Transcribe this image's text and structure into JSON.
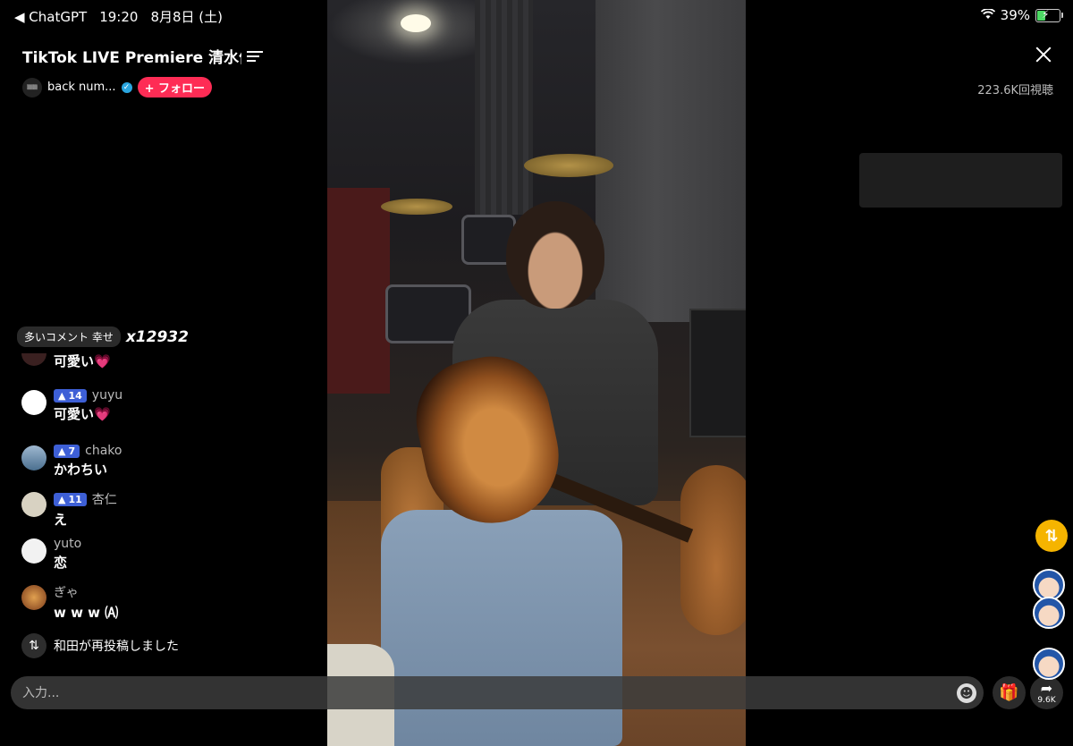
{
  "status_bar": {
    "back_app": "◀ ChatGPT",
    "time": "19:20",
    "date": "8月8日 (土)",
    "battery_pct": "39%",
    "battery_level": 0.39
  },
  "header": {
    "title": "TikTok LIVE Premiere 清水依与",
    "host_name": "back num...",
    "follow_label": "+ フォロー",
    "viewers": "223.6K回視聴"
  },
  "hot_comment": {
    "label": "多いコメント 幸せ",
    "count": "x12932"
  },
  "comments": [
    {
      "user": "",
      "level": "",
      "text": "可愛い💗",
      "avatar_color": "#3a2020"
    },
    {
      "user": "yuyu",
      "level": "14",
      "text": "可愛い💗",
      "avatar_color": "#ffffff"
    },
    {
      "user": "chako",
      "level": "7",
      "text": "かわちい",
      "avatar_color": "#6a8fb0"
    },
    {
      "user": "杏仁",
      "level": "11",
      "text": "え",
      "avatar_color": "#d8d2c2"
    },
    {
      "user": "yuto",
      "level": "",
      "text": "恋",
      "avatar_color": "#f2f2f2"
    },
    {
      "user": "ぎゃ",
      "level": "",
      "text": "w w w 🄐",
      "avatar_color": "#c9823a"
    }
  ],
  "repost_notice": "和田が再投稿しました",
  "input": {
    "placeholder": "入力..."
  },
  "actions": {
    "share_count": "9.6K"
  },
  "icons": {
    "back": "back-chevron-icon",
    "wifi": "wifi-icon",
    "battery": "battery-icon",
    "list": "list-icon",
    "close": "close-icon",
    "emoji": "emoji-icon",
    "gift": "gift-icon",
    "share": "share-icon",
    "repost": "repost-icon"
  },
  "colors": {
    "follow": "#fe2c55",
    "level_badge": "#3d5fd6",
    "repost_float": "#f5b400",
    "battery_fill": "#4cd964"
  }
}
